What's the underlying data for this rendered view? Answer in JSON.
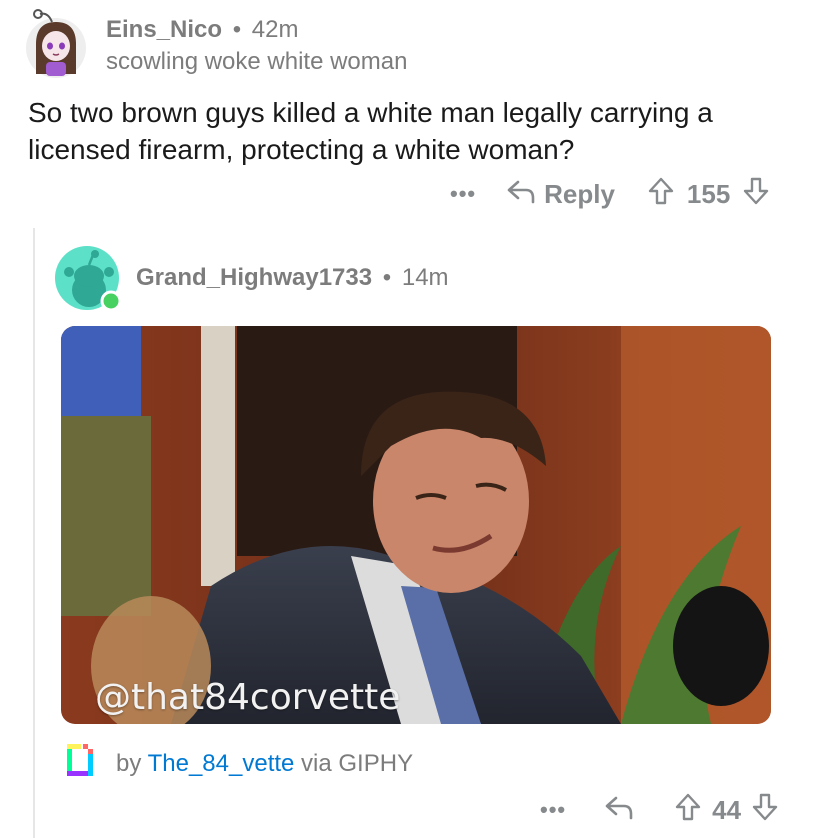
{
  "comment1": {
    "username": "Eins_Nico",
    "separator": "•",
    "time": "42m",
    "flair": "scowling woke white woman",
    "body_line1": "So two brown guys killed a white man legally carrying a",
    "body_line2": "licensed firearm, protecting a white woman?",
    "more": "•••",
    "reply_label": "Reply",
    "score": "155"
  },
  "comment2": {
    "username": "Grand_Highway1733",
    "separator": "•",
    "time": "14m",
    "gif_watermark": "@that84corvette",
    "giphy_by": "by ",
    "giphy_user": "The_84_vette",
    "giphy_via": " via GIPHY",
    "more": "•••",
    "score": "44"
  },
  "colors": {
    "meta_gray": "#7c7c7c",
    "action_gray": "#878a8c",
    "link_blue": "#0079d3",
    "online_green": "#46d160",
    "avatar2_bg": "#5de0c8"
  },
  "icons": [
    "more-icon",
    "reply-arrow-icon",
    "upvote-arrow-icon",
    "downvote-arrow-icon",
    "giphy-logo-icon",
    "online-dot-icon"
  ]
}
